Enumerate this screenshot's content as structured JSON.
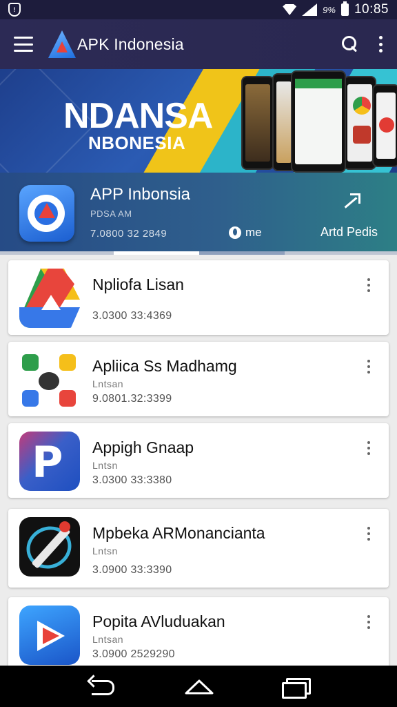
{
  "status_bar": {
    "battery_pct": "9%",
    "time": "10:85"
  },
  "app_bar": {
    "title": "APK Indonesia"
  },
  "banner": {
    "headline": "NDANSA",
    "subline": "NBONESIA"
  },
  "featured": {
    "title": "APP Inbonsia",
    "subtitle": "PDSA AM",
    "number": "7.0800 32 2849",
    "me_label": "me",
    "action_label": "Artd Pedis"
  },
  "apps": [
    {
      "name": "Npliofa Lisan",
      "developer": "",
      "number": "3.0300 33:4369",
      "icon": "drive-icon"
    },
    {
      "name": "Apliica Ss Madhamg",
      "developer": "Lntsan",
      "number": "9.0801.32:3399",
      "icon": "grid-icon"
    },
    {
      "name": "Appigh Gnaap",
      "developer": "Lntsn",
      "number": "3.0300 33:3380",
      "icon": "p-icon"
    },
    {
      "name": "Mpbeka ARMonancianta",
      "developer": "Lntsn",
      "number": "3.0900 33:3390",
      "icon": "pen-icon"
    },
    {
      "name": "Popita AVluduakan",
      "developer": "Lntsan",
      "number": "3.0900 2529290",
      "icon": "play-icon"
    }
  ],
  "colors": {
    "status_bar": "#1d1c3c",
    "app_bar": "#2c2a55",
    "list_background": "#ececec"
  }
}
